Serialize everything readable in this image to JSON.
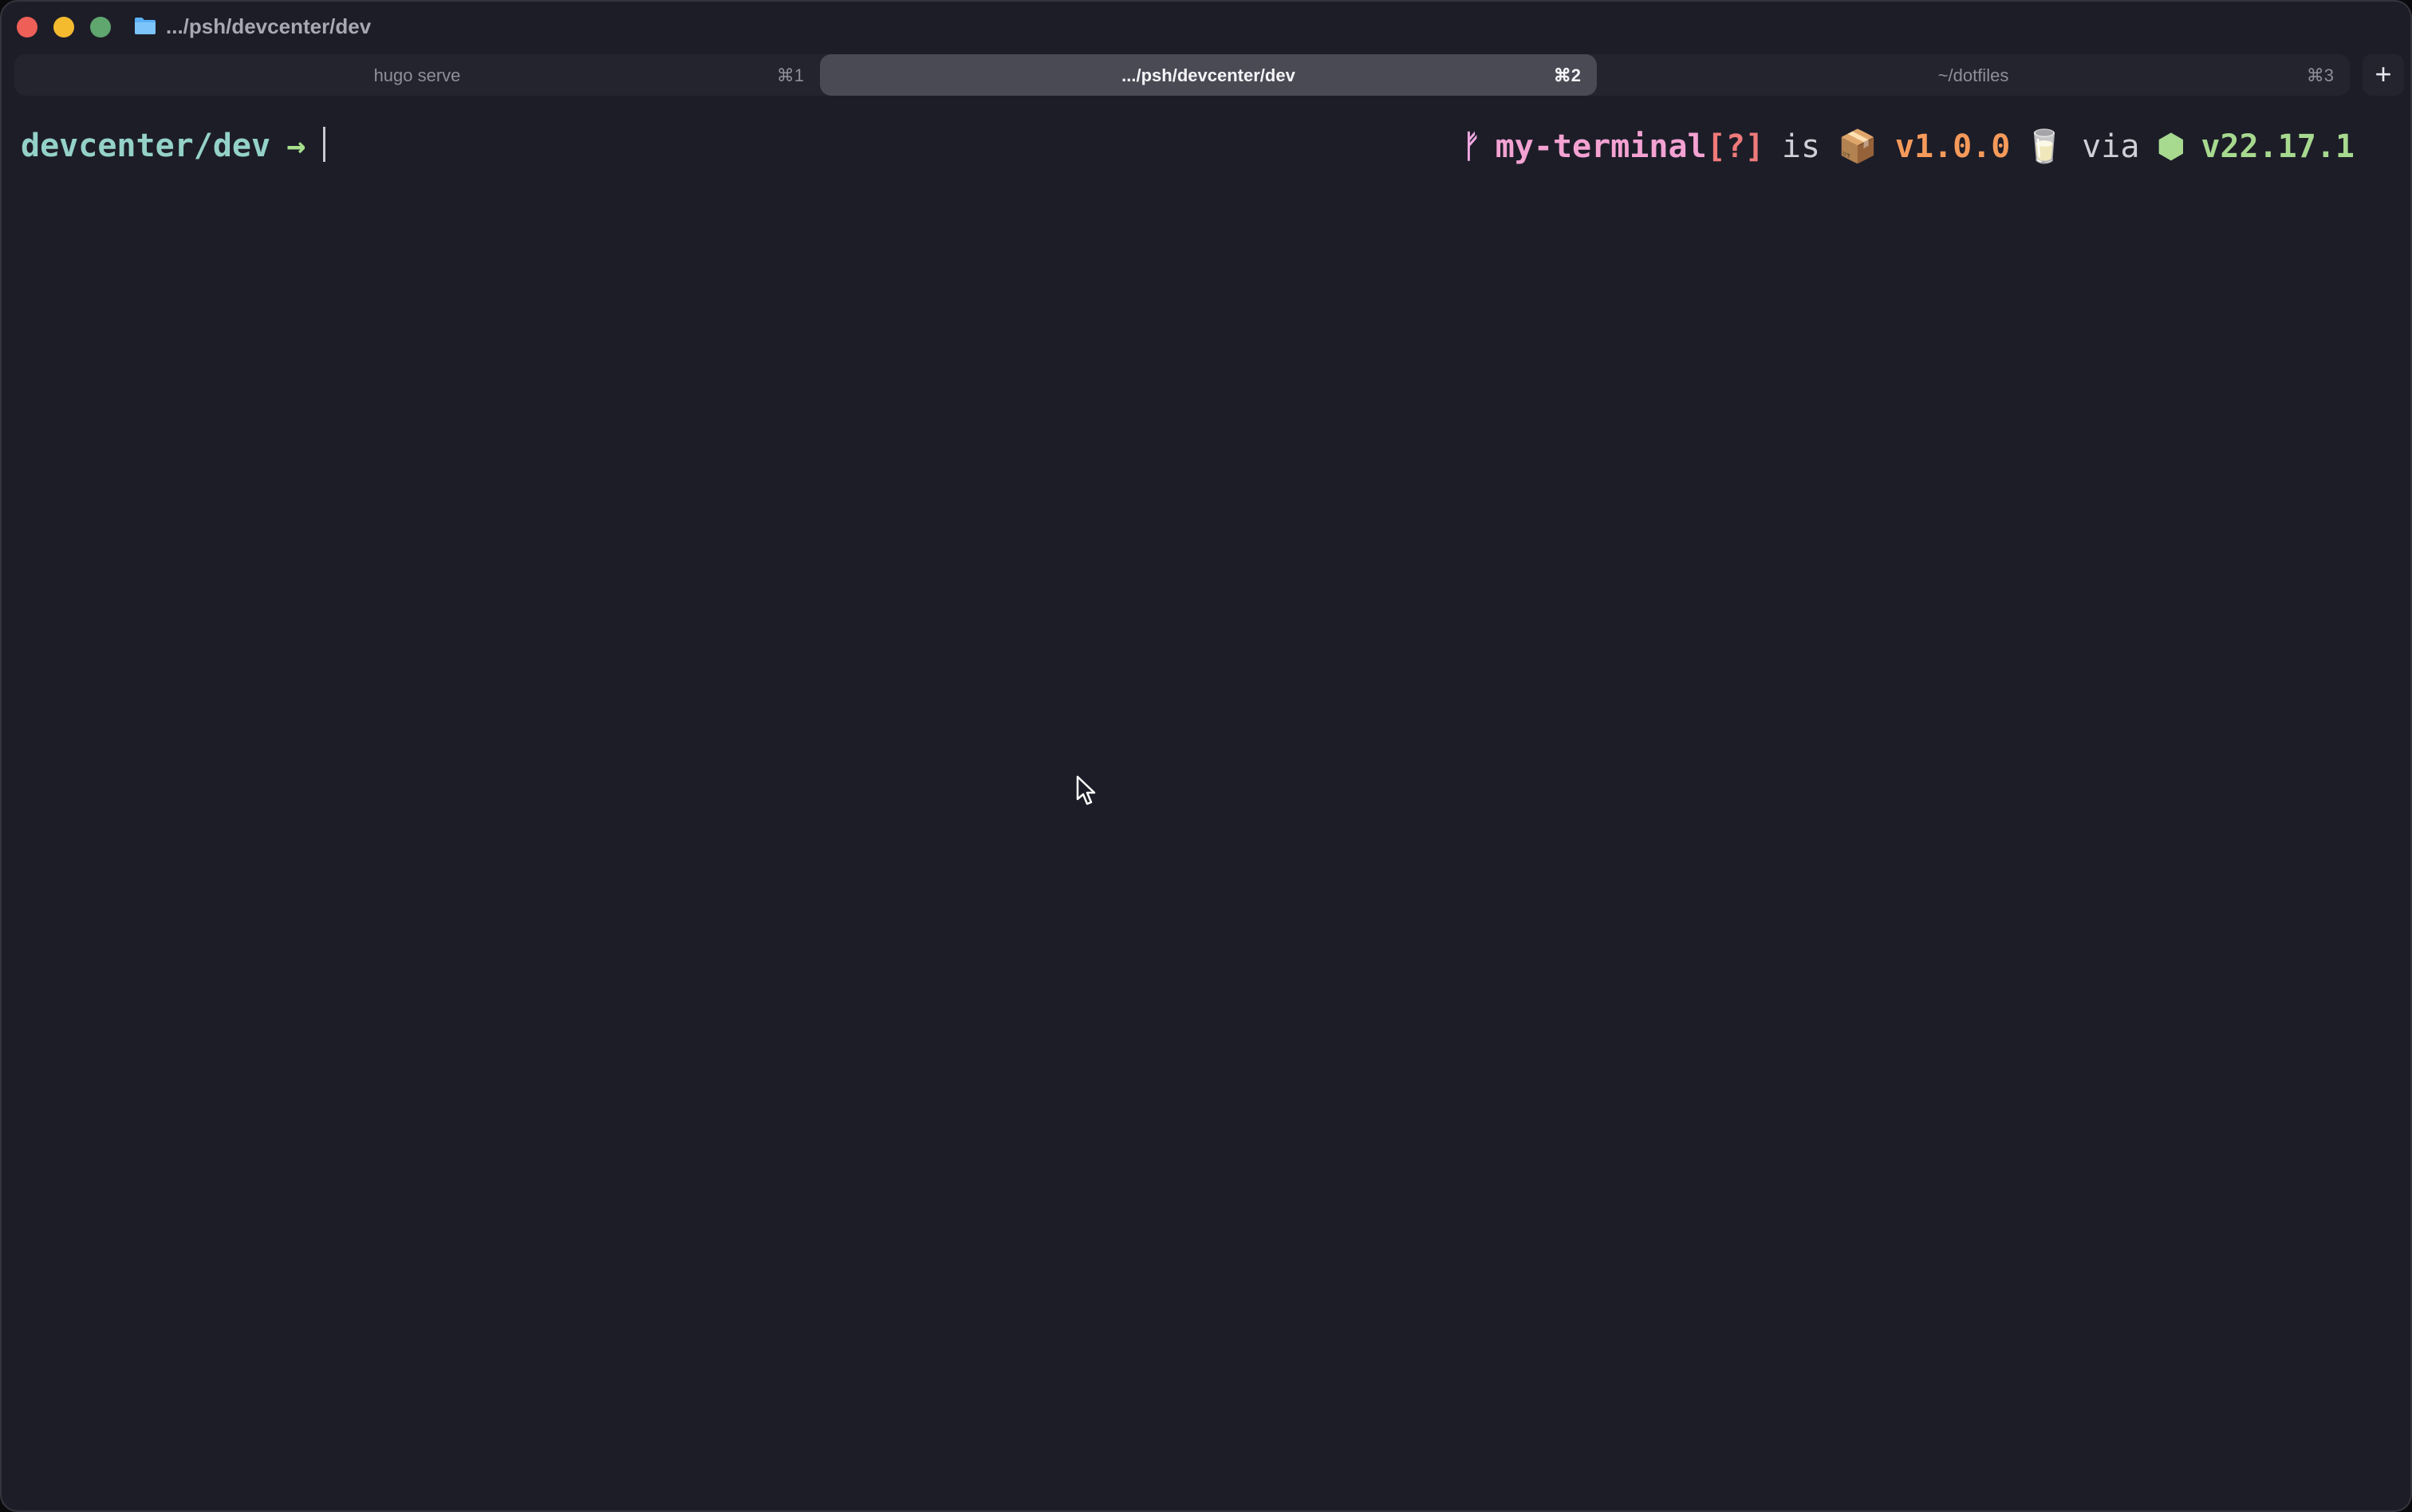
{
  "window": {
    "title": ".../psh/devcenter/dev"
  },
  "tabs": [
    {
      "label": "hugo serve",
      "shortcut": "⌘1",
      "active": false
    },
    {
      "label": ".../psh/devcenter/dev",
      "shortcut": "⌘2",
      "active": true
    },
    {
      "label": "~/dotfiles",
      "shortcut": "⌘3",
      "active": false
    }
  ],
  "new_tab_label": "+",
  "prompt": {
    "cwd": "devcenter/dev",
    "arrow": "→",
    "right": {
      "branch_icon": "ᚠ",
      "repo": "my-terminal",
      "git_status": "[?]",
      "is_word": "is",
      "package_icon": "📦",
      "package_version": "v1.0.0",
      "runtime_icon": "🥛",
      "via_word": "via",
      "node_icon": "⬢",
      "node_version": "v22.17.1"
    }
  },
  "colors": {
    "background": "#1d1d28",
    "cwd": "#94d2c9",
    "arrow": "#a7e08d",
    "repo": "#f3a2d2",
    "git_status": "#f07a7a",
    "package_version": "#f59a5a",
    "node_version": "#a7d98f"
  }
}
